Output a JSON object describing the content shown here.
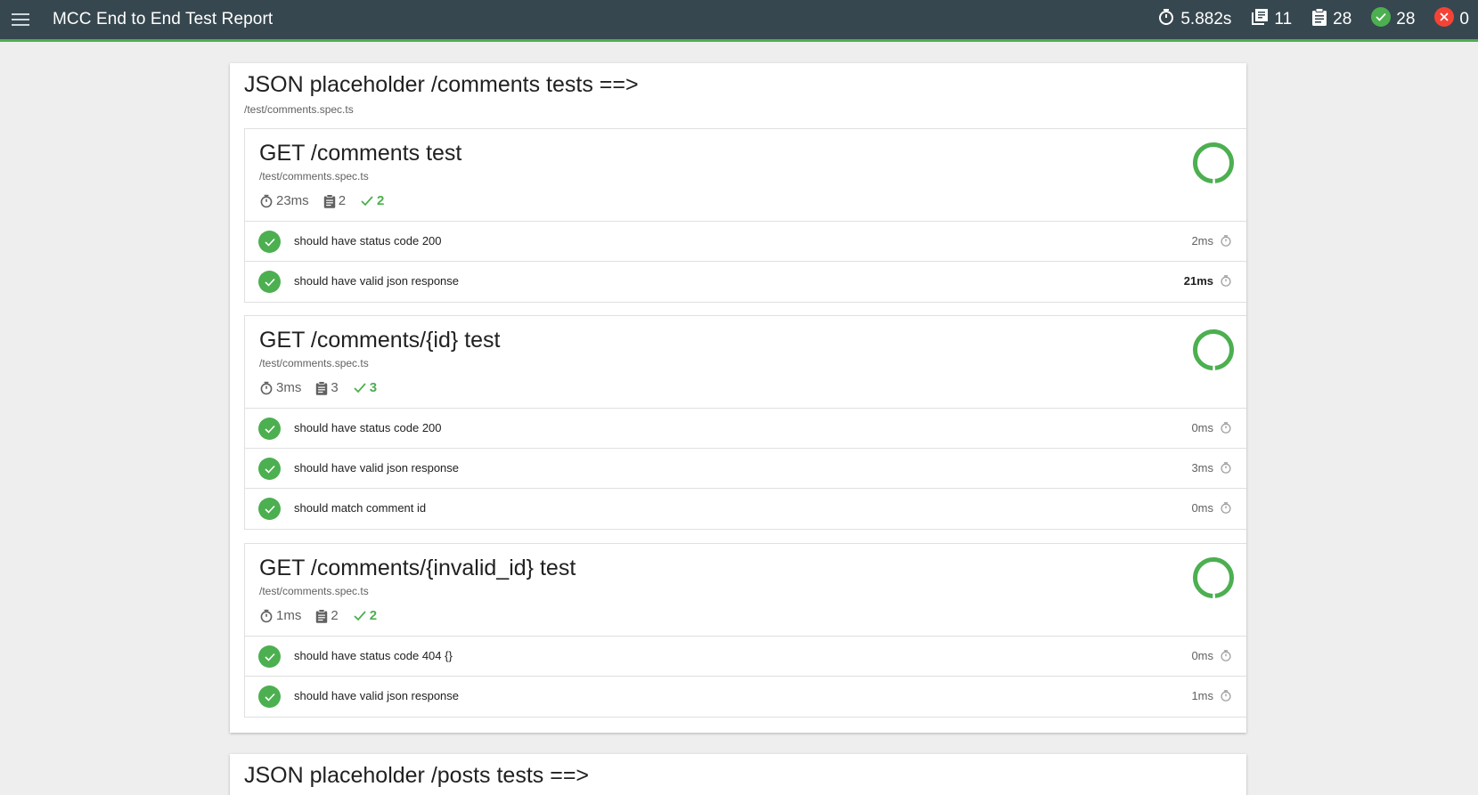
{
  "header": {
    "title": "MCC End to End Test Report",
    "stats": {
      "duration": "5.882s",
      "suites": "11",
      "tests": "28",
      "passes": "28",
      "failures": "0"
    }
  },
  "colors": {
    "toolbar": "#37474f",
    "pass": "#4caf50",
    "fail": "#f44336"
  },
  "suites": [
    {
      "title": "JSON placeholder /comments tests ==>",
      "file": "/test/comments.spec.ts",
      "tests": [
        {
          "title": "GET /comments test",
          "file": "/test/comments.spec.ts",
          "duration": "23ms",
          "count": "2",
          "passes": "2",
          "cases": [
            {
              "title": "should have status code 200",
              "duration": "2ms"
            },
            {
              "title": "should have valid json response",
              "duration": "21ms"
            }
          ]
        },
        {
          "title": "GET /comments/{id} test",
          "file": "/test/comments.spec.ts",
          "duration": "3ms",
          "count": "3",
          "passes": "3",
          "cases": [
            {
              "title": "should have status code 200",
              "duration": "0ms"
            },
            {
              "title": "should have valid json response",
              "duration": "3ms"
            },
            {
              "title": "should match comment id",
              "duration": "0ms"
            }
          ]
        },
        {
          "title": "GET /comments/{invalid_id} test",
          "file": "/test/comments.spec.ts",
          "duration": "1ms",
          "count": "2",
          "passes": "2",
          "cases": [
            {
              "title": "should have status code 404 {}",
              "duration": "0ms"
            },
            {
              "title": "should have valid json response",
              "duration": "1ms"
            }
          ]
        }
      ]
    },
    {
      "title": "JSON placeholder /posts tests ==>"
    }
  ]
}
